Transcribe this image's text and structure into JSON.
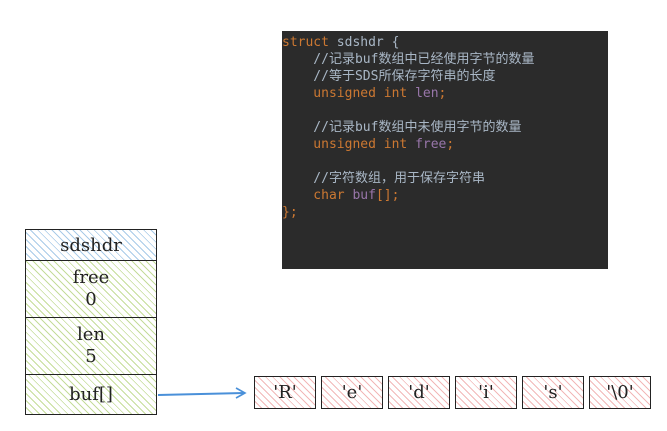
{
  "code": {
    "lines": [
      [
        {
          "t": "struct",
          "c": "kw"
        },
        {
          "t": " sdshdr ",
          "c": "ident"
        },
        {
          "t": "{",
          "c": "brace"
        }
      ],
      [
        {
          "t": "    //记录buf数组中已经使用字节的数量",
          "c": "comment"
        }
      ],
      [
        {
          "t": "    //等于SDS所保存字符串的长度",
          "c": "comment"
        }
      ],
      [
        {
          "t": "    unsigned int ",
          "c": "type"
        },
        {
          "t": "len",
          "c": "var"
        },
        {
          "t": ";",
          "c": "punc"
        }
      ],
      [
        {
          "t": "",
          "c": "ident"
        }
      ],
      [
        {
          "t": "    //记录buf数组中未使用字节的数量",
          "c": "comment"
        }
      ],
      [
        {
          "t": "    unsigned int ",
          "c": "type"
        },
        {
          "t": "free",
          "c": "var"
        },
        {
          "t": ";",
          "c": "punc"
        }
      ],
      [
        {
          "t": "",
          "c": "ident"
        }
      ],
      [
        {
          "t": "    //字符数组，用于保存字符串",
          "c": "comment"
        }
      ],
      [
        {
          "t": "    char ",
          "c": "type"
        },
        {
          "t": "buf",
          "c": "var"
        },
        {
          "t": "[];",
          "c": "punc"
        }
      ],
      [
        {
          "t": "};",
          "c": "punc"
        }
      ]
    ]
  },
  "struct": {
    "header": "sdshdr",
    "free_label": "free",
    "free_value": "0",
    "len_label": "len",
    "len_value": "5",
    "buf_label": "buf[]"
  },
  "buf_array": [
    "'R'",
    "'e'",
    "'d'",
    "'i'",
    "'s'",
    "'\\0'"
  ],
  "colors": {
    "code_background": "#2b2b2b",
    "header_hatch": "#a9cbe8",
    "field_hatch": "#c5dd9a",
    "array_hatch": "#f2b8b8",
    "arrow": "#4a90d9"
  }
}
